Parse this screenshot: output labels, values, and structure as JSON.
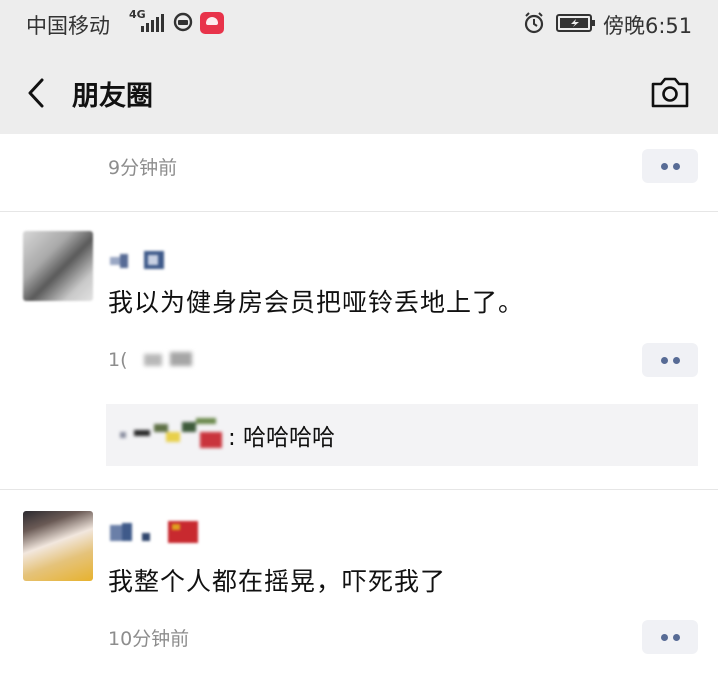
{
  "status_bar": {
    "carrier": "中国移动",
    "network_type": "4G",
    "time": "傍晚6:51"
  },
  "nav": {
    "title": "朋友圈",
    "back_icon": "chevron-left-icon",
    "camera_icon": "camera-icon"
  },
  "feed": {
    "top_post": {
      "time": "9分钟前"
    },
    "posts": [
      {
        "text": "我以为健身房会员把哑铃丢地上了。",
        "time_visible": "1(",
        "comments": [
          {
            "text": ": 哈哈哈哈"
          }
        ]
      },
      {
        "text": "我整个人都在摇晃，吓死我了",
        "time": "10分钟前"
      }
    ]
  },
  "colors": {
    "header_bg": "#ededed",
    "link_blue": "#576b95",
    "meta_gray": "#8d8d8d",
    "comment_bg": "#f3f3f5"
  }
}
